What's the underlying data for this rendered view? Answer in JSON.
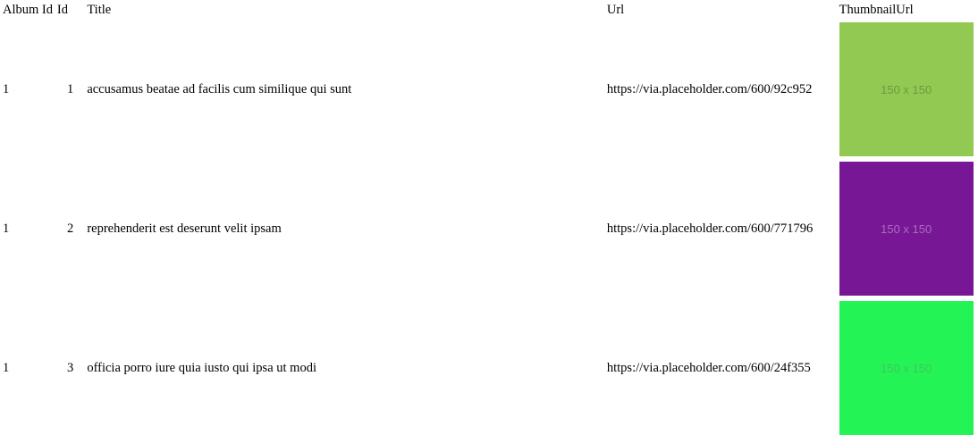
{
  "headers": {
    "album_id": "Album Id",
    "id": "Id",
    "title": "Title",
    "url": "Url",
    "thumbnail_url": "ThumbnailUrl"
  },
  "rows": [
    {
      "album_id": "1",
      "id": "1",
      "title": "accusamus beatae ad facilis cum similique qui sunt",
      "url": "https://via.placeholder.com/600/92c952",
      "thumb_label": "150 x 150",
      "thumb_bg": "#92c952",
      "thumb_fg": "#6e9a3d"
    },
    {
      "album_id": "1",
      "id": "2",
      "title": "reprehenderit est deserunt velit ipsam",
      "url": "https://via.placeholder.com/600/771796",
      "thumb_label": "150 x 150",
      "thumb_bg": "#771796",
      "thumb_fg": "#a86dbd"
    },
    {
      "album_id": "1",
      "id": "3",
      "title": "officia porro iure quia iusto qui ipsa ut modi",
      "url": "https://via.placeholder.com/600/24f355",
      "thumb_label": "150 x 150",
      "thumb_bg": "#24f355",
      "thumb_fg": "#3fc560"
    }
  ]
}
